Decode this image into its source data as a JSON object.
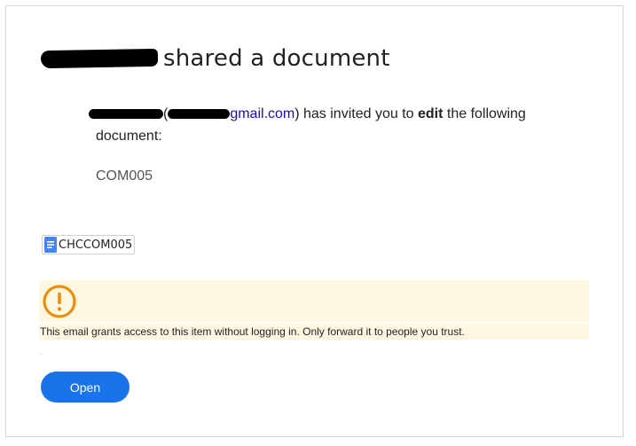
{
  "header": {
    "title_suffix": "shared a document"
  },
  "invite": {
    "open_paren": "(",
    "email_domain": "gmail.com",
    "after_email": ") has invited you to ",
    "permission": "edit",
    "after_permission": " the following document:"
  },
  "document": {
    "code": "COM005",
    "chip_label": "CHCCOM005",
    "chip_icon": "google-docs-icon"
  },
  "warning": {
    "icon": "exclamation-circle-icon",
    "text": "This email grants access to this item without logging in. Only forward it to people you trust."
  },
  "actions": {
    "open_label": "Open"
  },
  "colors": {
    "accent": "#1a73e8",
    "link": "#1a0dab",
    "warning_bg": "#fdf7e2",
    "warning_icon": "#e8900c",
    "docs_blue": "#4285f4"
  }
}
